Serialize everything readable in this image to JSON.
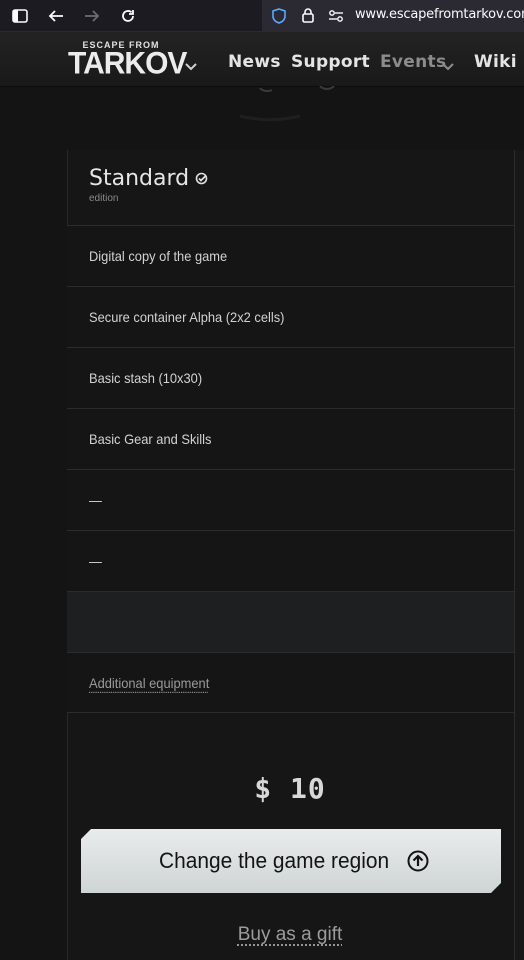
{
  "browser": {
    "url": "www.escapefromtarkov.com"
  },
  "header": {
    "logo_top": "ESCAPE FROM",
    "logo_main": "TARKOV",
    "nav": [
      "News",
      "Support",
      "Events",
      "Wiki"
    ]
  },
  "edition": {
    "title": "Standard",
    "subtitle": "edition",
    "features": [
      "Digital copy of the game",
      "Secure container Alpha (2x2 cells)",
      "Basic stash (10x30)",
      "Basic Gear and Skills",
      "—",
      "—",
      ""
    ],
    "additional": "Additional equipment",
    "price": "$ 10",
    "region_button": "Change the game region",
    "gift_link": "Buy as a gift"
  },
  "colors": {
    "background": "#141414",
    "button": "#dde1e1",
    "text": "#d6d6d6"
  }
}
